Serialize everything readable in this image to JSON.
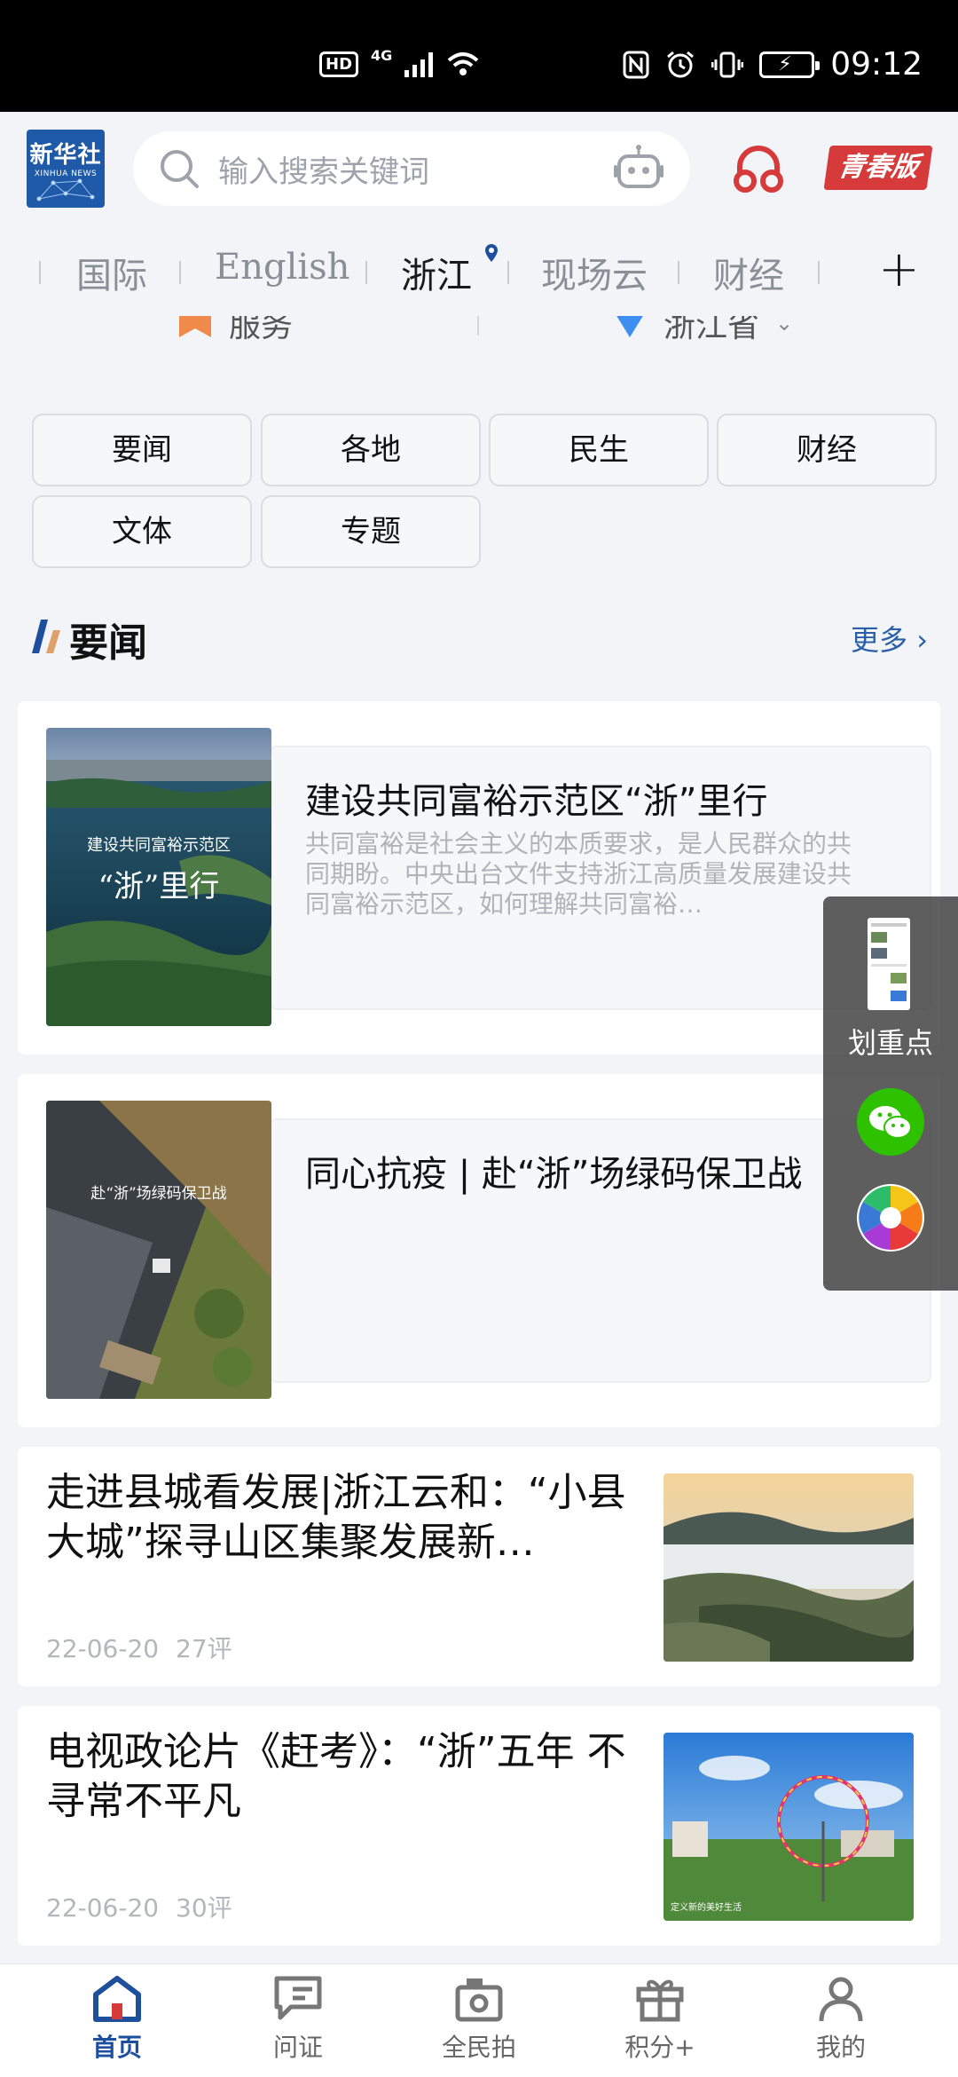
{
  "status_bar": {
    "time": "09:12",
    "hd_label": "HD",
    "network_label": "4G"
  },
  "header": {
    "logo_text": "新华社",
    "logo_subtext": "XINHUA NEWS",
    "search_placeholder": "输入搜索关键词",
    "youth_label": "青春版"
  },
  "tabs": [
    {
      "label": "国际"
    },
    {
      "label": "English"
    },
    {
      "label": "浙江"
    },
    {
      "label": "现场云"
    },
    {
      "label": "财经"
    }
  ],
  "service_row": {
    "left_label": "服务",
    "right_label": "浙江省"
  },
  "categories": [
    {
      "label": "要闻"
    },
    {
      "label": "各地"
    },
    {
      "label": "民生"
    },
    {
      "label": "财经"
    },
    {
      "label": "文体"
    },
    {
      "label": "专题"
    }
  ],
  "section": {
    "title": "要闻",
    "more_label": "更多 ›"
  },
  "feature_cards": [
    {
      "title": "建设共同富裕示范区“浙”里行",
      "description": "共同富裕是社会主义的本质要求，是人民群众的共同期盼。中央出台文件支持浙江高质量发展建设共同富裕示范区，如何理解共同富裕…",
      "image_caption_1": "建设共同富裕示范区",
      "image_caption_2": "“浙”里行"
    },
    {
      "title": "同心抗疫 | 赴“浙”场绿码保卫战",
      "description": "",
      "image_caption_1": "赴“浙”场绿码保卫战"
    }
  ],
  "news_items": [
    {
      "title": "走进县城看发展|浙江云和：“小县大城”探寻山区集聚发展新…",
      "date": "22-06-20",
      "comments": "27评"
    },
    {
      "title": "电视政论片《赶考》：“浙”五年 不寻常不平凡",
      "date": "22-06-20",
      "comments": "30评",
      "image_caption": "定义新的美好生活"
    }
  ],
  "float_panel": {
    "label": "划重点"
  },
  "bottom_nav": [
    {
      "label": "首页",
      "active": true
    },
    {
      "label": "问证"
    },
    {
      "label": "全民拍"
    },
    {
      "label": "积分+"
    },
    {
      "label": "我的"
    }
  ],
  "colors": {
    "accent_blue": "#1d4f9c",
    "youth_red": "#d63a3a",
    "logo_blue": "#1f5aa8"
  }
}
